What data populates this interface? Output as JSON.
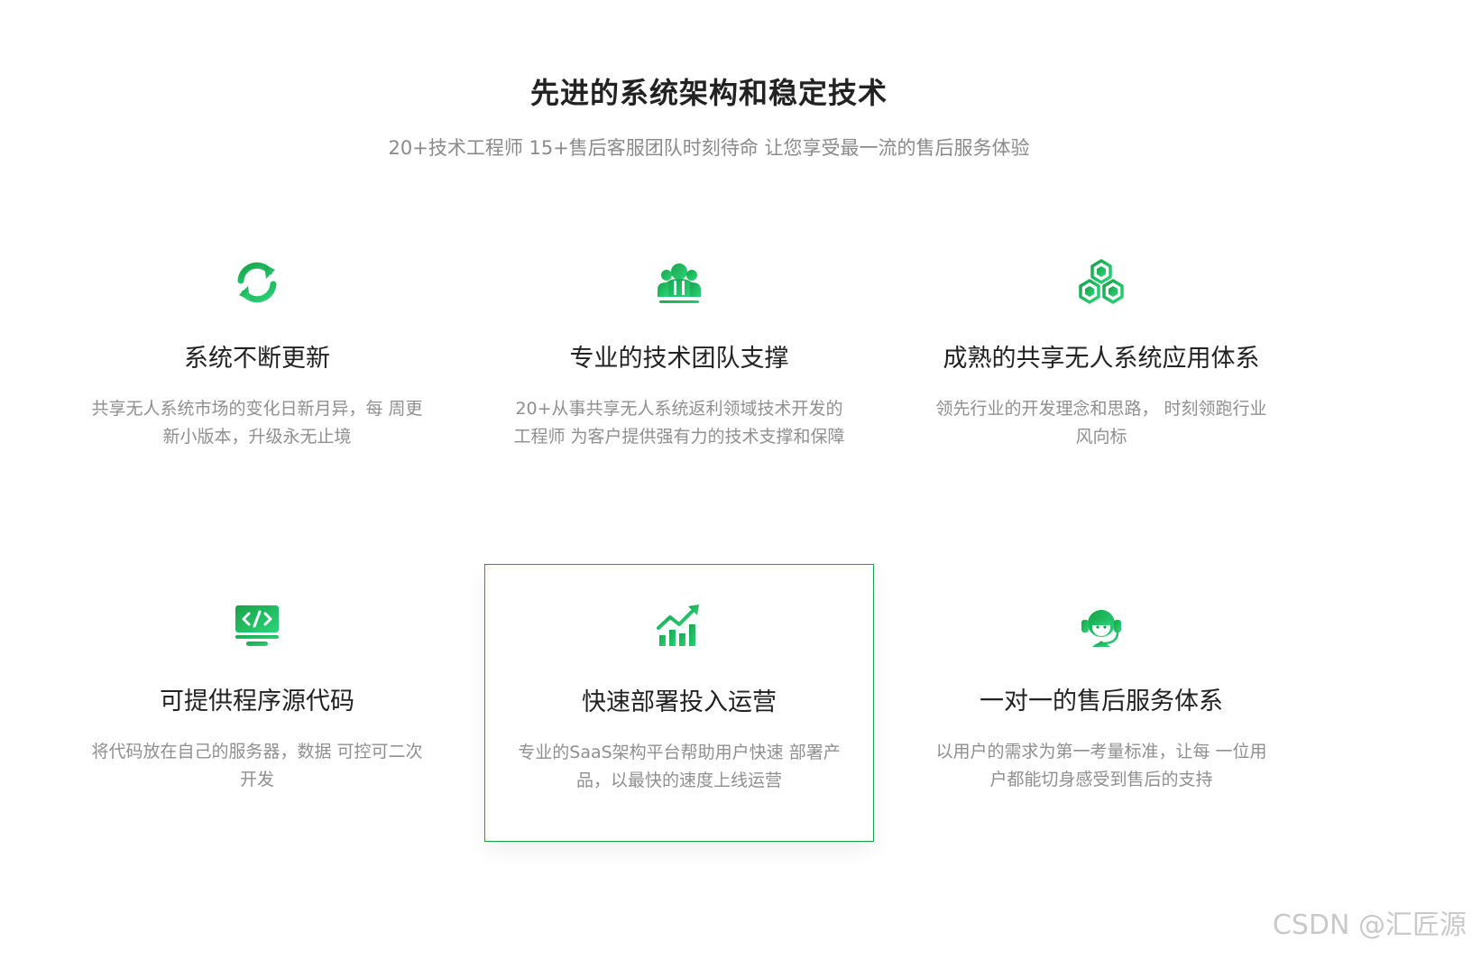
{
  "section": {
    "title": "先进的系统架构和稳定技术",
    "subtitle": "20+技术工程师 15+售后客服团队时刻待命 让您享受最一流的售后服务体验"
  },
  "features": [
    {
      "icon": "refresh-icon",
      "title": "系统不断更新",
      "desc": "共享无人系统市场的变化日新月异，每 周更新小版本，升级永无止境"
    },
    {
      "icon": "team-icon",
      "title": "专业的技术团队支撑",
      "desc": "20+从事共享无人系统返利领域技术开发的工程师 为客户提供强有力的技术支撑和保障"
    },
    {
      "icon": "cubes-icon",
      "title": "成熟的共享无人系统应用体系",
      "desc": "领先行业的开发理念和思路， 时刻领跑行业风向标"
    },
    {
      "icon": "code-monitor-icon",
      "title": "可提供程序源代码",
      "desc": "将代码放在自己的服务器，数据 可控可二次开发"
    },
    {
      "icon": "growth-chart-icon",
      "title": "快速部署投入运营",
      "desc": "专业的SaaS架构平台帮助用户快速 部署产品，以最快的速度上线运营"
    },
    {
      "icon": "headset-icon",
      "title": "一对一的售后服务体系",
      "desc": "以用户的需求为第一考量标准，让每 一位用户都能切身感受到售后的支持"
    }
  ],
  "watermark": "CSDN @汇匠源",
  "colors": {
    "accent": "#16a34a",
    "accent_light": "#22c55e",
    "heading": "#222222",
    "muted": "#8f8f8f"
  }
}
